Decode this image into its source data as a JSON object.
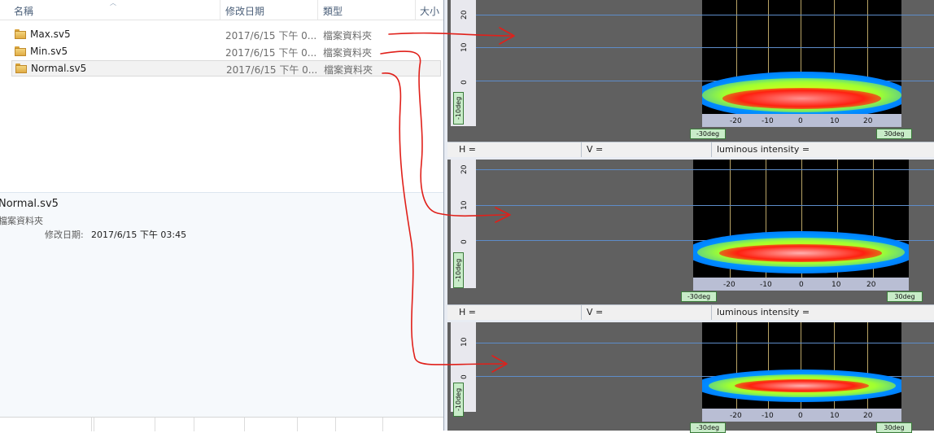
{
  "explorer": {
    "columns": {
      "name": "名稱",
      "date": "修改日期",
      "type": "類型",
      "size": "大小"
    },
    "rows": [
      {
        "name": "Max.sv5",
        "date": "2017/6/15 下午 0...",
        "type": "檔案資料夾"
      },
      {
        "name": "Min.sv5",
        "date": "2017/6/15 下午 0...",
        "type": "檔案資料夾"
      },
      {
        "name": "Normal.sv5",
        "date": "2017/6/15 下午 0...",
        "type": "檔案資料夾"
      }
    ],
    "details": {
      "name": "Normal.sv5",
      "type": "檔案資料夾",
      "modified_label": "修改日期:",
      "modified_value": "2017/6/15 下午 03:45"
    }
  },
  "plots": [
    {
      "y_ticks": [
        "20",
        "10",
        "0"
      ],
      "y_bottom_label": "-10deg",
      "x_ticks": [
        "-20",
        "-10",
        "0",
        "10",
        "20"
      ],
      "x_left_label": "-30deg",
      "x_right_label": "30deg",
      "status": {
        "h": "H =",
        "v": "V =",
        "li": "luminous intensity ="
      }
    },
    {
      "y_ticks": [
        "20",
        "10",
        "0"
      ],
      "y_bottom_label": "-10deg",
      "x_ticks": [
        "-20",
        "-10",
        "0",
        "10",
        "20"
      ],
      "x_left_label": "-30deg",
      "x_right_label": "30deg",
      "status": {
        "h": "H =",
        "v": "V =",
        "li": "luminous intensity ="
      }
    },
    {
      "y_ticks": [
        "10",
        "0"
      ],
      "y_bottom_label": "-10deg",
      "x_ticks": [
        "-20",
        "-10",
        "0",
        "10",
        "20"
      ],
      "x_left_label": "-30deg",
      "x_right_label": "30deg"
    }
  ],
  "colors": {
    "annotation_arrow": "#e0201a",
    "grid_blue": "#5d8cc9",
    "grid_yellow": "#d9c178",
    "plot_bg": "#606060"
  }
}
